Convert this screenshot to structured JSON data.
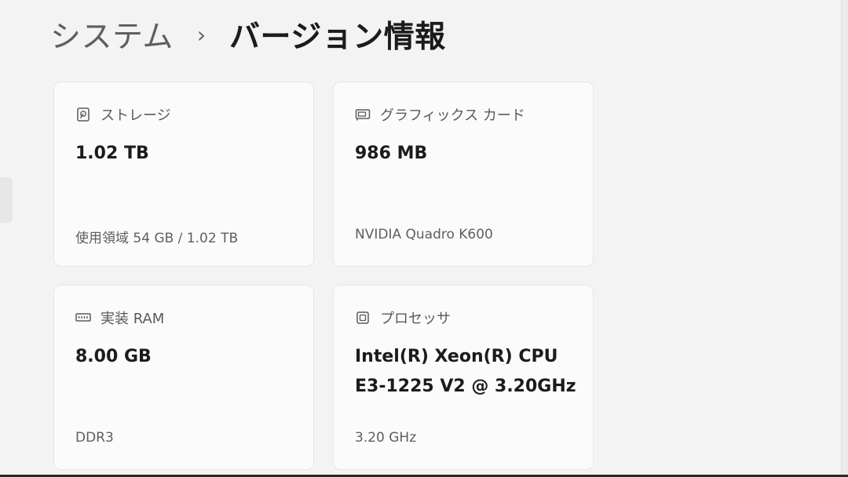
{
  "breadcrumb": {
    "parent": "システム",
    "separator": "›",
    "current": "バージョン情報"
  },
  "cards": [
    {
      "icon": "storage-drive-icon",
      "label": "ストレージ",
      "value": "1.02 TB",
      "sub": "使用領域 54 GB / 1.02 TB"
    },
    {
      "icon": "graphics-card-icon",
      "label": "グラフィックス カード",
      "value": "986 MB",
      "sub": "NVIDIA Quadro K600"
    },
    {
      "icon": "ram-module-icon",
      "label": "実装 RAM",
      "value": "8.00 GB",
      "sub": "DDR3"
    },
    {
      "icon": "processor-chip-icon",
      "label": "プロセッサ",
      "value_line1": "Intel(R) Xeon(R) CPU",
      "value_line2": "E3-1225 V2 @ 3.20GHz",
      "sub": "3.20 GHz"
    }
  ]
}
